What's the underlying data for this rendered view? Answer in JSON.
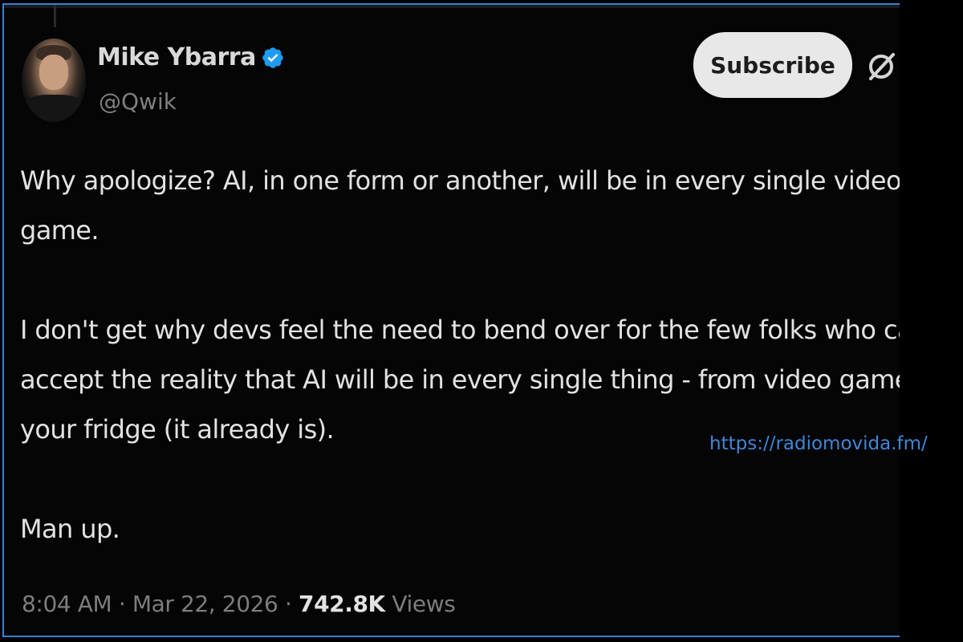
{
  "author": {
    "name": "Mike Ybarra",
    "handle": "@Qwik",
    "verified": true
  },
  "subscribe_label": "Subscribe",
  "tweet": {
    "lines": [
      "Why apologize? AI, in one form or another, will be in every single video",
      "game.",
      "",
      "I don't get why devs feel the need to bend over for the few folks who car",
      "accept the reality that AI will be in every single thing - from video games",
      "your fridge (it already is).",
      "",
      "Man up."
    ]
  },
  "meta": {
    "time": "8:04 AM",
    "date": "Mar 22, 2026",
    "views_count": "742.8K",
    "views_label": "Views"
  },
  "watermark": "https://radiomovida.fm/",
  "icons": {
    "verified": "verified-badge-icon",
    "grok": "grok-icon"
  },
  "colors": {
    "background": "#000000",
    "verified": "#1d9bf0",
    "watermark": "#3f86d9",
    "frame": "#3b7fd6"
  }
}
